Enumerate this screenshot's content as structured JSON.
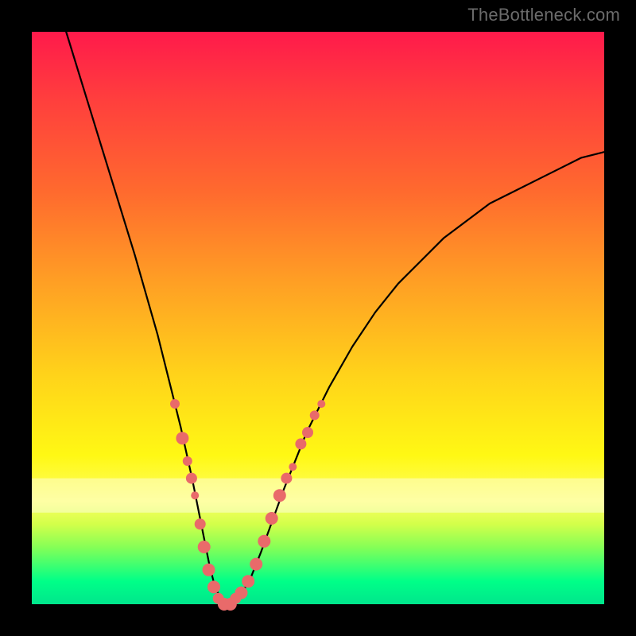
{
  "watermark": "TheBottleneck.com",
  "colors": {
    "frame": "#000000",
    "curve": "#000000",
    "dot_fill": "#e96a6a",
    "gradient_top": "#ff1a4b",
    "gradient_bottom": "#00e68c"
  },
  "chart_data": {
    "type": "line",
    "title": "",
    "xlabel": "",
    "ylabel": "",
    "xlim": [
      0,
      100
    ],
    "ylim": [
      0,
      100
    ],
    "series": [
      {
        "name": "curve",
        "x": [
          6,
          10,
          14,
          18,
          20,
          22,
          24,
          26,
          28,
          29,
          30,
          31,
          32,
          33,
          34,
          35,
          36,
          38,
          40,
          44,
          48,
          52,
          56,
          60,
          64,
          68,
          72,
          76,
          80,
          84,
          88,
          92,
          96,
          100
        ],
        "y": [
          100,
          87,
          74,
          61,
          54,
          47,
          39,
          31,
          22,
          17,
          12,
          7,
          3,
          1,
          0,
          0,
          1,
          4,
          9,
          20,
          30,
          38,
          45,
          51,
          56,
          60,
          64,
          67,
          70,
          72,
          74,
          76,
          78,
          79
        ]
      }
    ],
    "markers": [
      {
        "x": 25.0,
        "y": 35,
        "r": 6
      },
      {
        "x": 26.3,
        "y": 29,
        "r": 8
      },
      {
        "x": 27.2,
        "y": 25,
        "r": 6
      },
      {
        "x": 27.9,
        "y": 22,
        "r": 7
      },
      {
        "x": 28.5,
        "y": 19,
        "r": 5
      },
      {
        "x": 29.4,
        "y": 14,
        "r": 7
      },
      {
        "x": 30.1,
        "y": 10,
        "r": 8
      },
      {
        "x": 30.9,
        "y": 6,
        "r": 8
      },
      {
        "x": 31.8,
        "y": 3,
        "r": 8
      },
      {
        "x": 32.6,
        "y": 1,
        "r": 7
      },
      {
        "x": 33.6,
        "y": 0,
        "r": 8
      },
      {
        "x": 34.7,
        "y": 0,
        "r": 8
      },
      {
        "x": 35.6,
        "y": 1,
        "r": 7
      },
      {
        "x": 36.6,
        "y": 2,
        "r": 8
      },
      {
        "x": 37.8,
        "y": 4,
        "r": 8
      },
      {
        "x": 39.2,
        "y": 7,
        "r": 8
      },
      {
        "x": 40.6,
        "y": 11,
        "r": 8
      },
      {
        "x": 41.9,
        "y": 15,
        "r": 8
      },
      {
        "x": 43.3,
        "y": 19,
        "r": 8
      },
      {
        "x": 44.5,
        "y": 22,
        "r": 7
      },
      {
        "x": 45.6,
        "y": 24,
        "r": 5
      },
      {
        "x": 47.0,
        "y": 28,
        "r": 7
      },
      {
        "x": 48.2,
        "y": 30,
        "r": 7
      },
      {
        "x": 49.4,
        "y": 33,
        "r": 6
      },
      {
        "x": 50.6,
        "y": 35,
        "r": 5
      }
    ],
    "bands_pale": [
      {
        "y0": 78,
        "y1": 84
      }
    ]
  }
}
